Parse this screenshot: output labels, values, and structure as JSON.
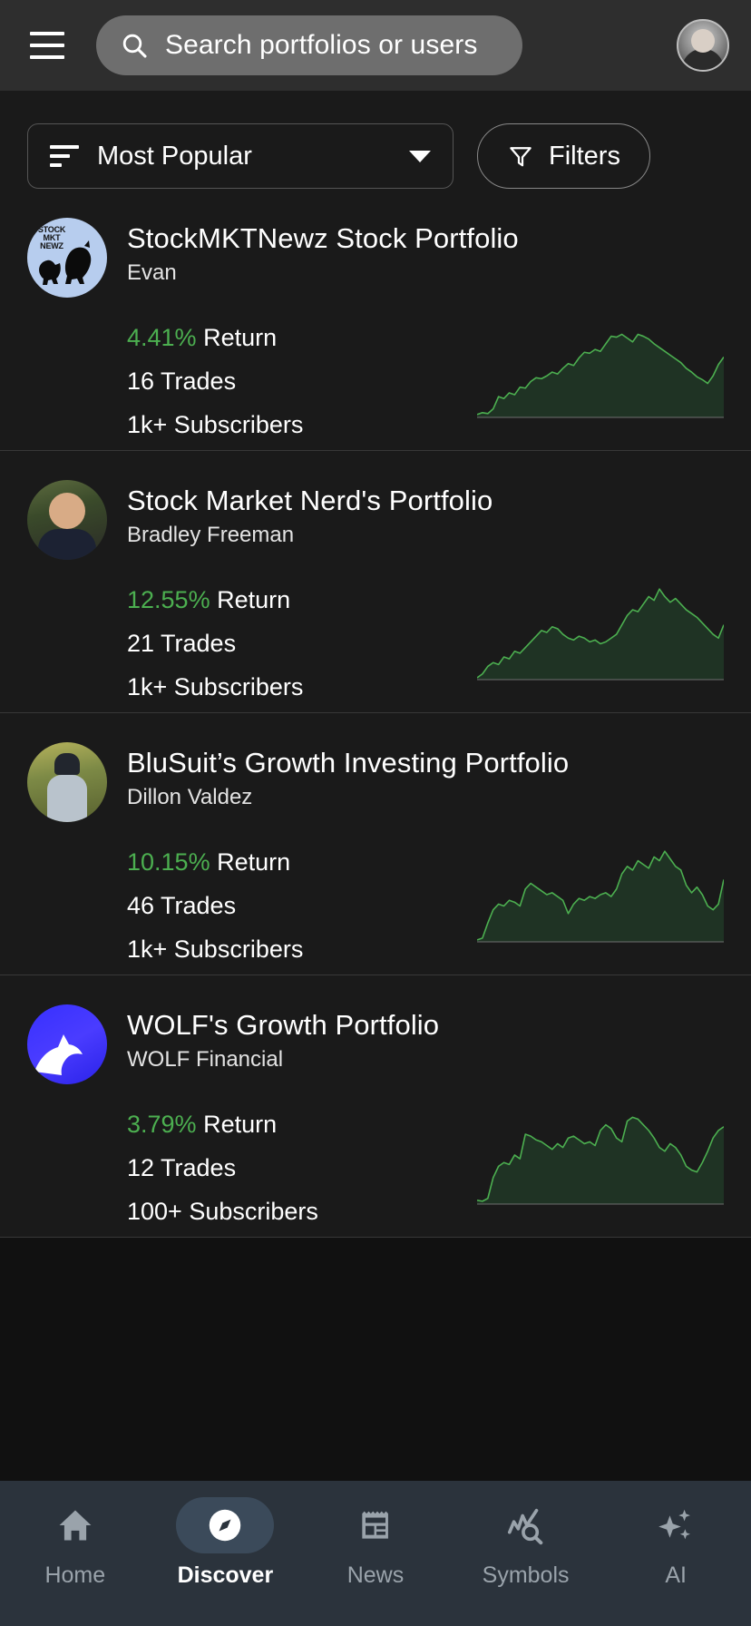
{
  "header": {
    "menu_icon": "hamburger-menu-icon",
    "search": {
      "placeholder": "Search portfolios or users",
      "icon": "search-icon"
    },
    "avatar": "user-avatar"
  },
  "controls": {
    "sort": {
      "label": "Most Popular",
      "icon": "sort-icon",
      "caret": "chevron-down-icon"
    },
    "filters": {
      "label": "Filters",
      "icon": "funnel-icon"
    }
  },
  "colors": {
    "background": "#1A1A1A",
    "header_bg": "#2E2E2E",
    "search_bg": "#6E6E6E",
    "return_green": "#4CAF50",
    "spark_line": "#4CAF50",
    "spark_fill": "#1F3324",
    "nav_bg": "#2B333C",
    "nav_active_pill": "#3B4A5A",
    "nav_inactive_text": "#9AA3AB",
    "divider": "#383838"
  },
  "portfolios": [
    {
      "title": "StockMKTNewz Stock Portfolio",
      "author": "Evan",
      "return": "4.41%",
      "return_word": "Return",
      "trades": "16 Trades",
      "subscribers": "1k+ Subscribers",
      "avatar": "stockmktnewz-bull-bear-logo",
      "chart_data": {
        "type": "area",
        "title": "StockMKTNewz Stock Portfolio sparkline",
        "xlabel": "",
        "ylabel": "",
        "grid": false,
        "legend": null,
        "ylim": [
          0,
          100
        ],
        "values": [
          3,
          5,
          4,
          9,
          22,
          20,
          26,
          24,
          32,
          31,
          38,
          42,
          41,
          44,
          48,
          46,
          52,
          57,
          55,
          63,
          69,
          68,
          72,
          70,
          78,
          86,
          85,
          88,
          84,
          80,
          88,
          86,
          83,
          78,
          74,
          70,
          66,
          62,
          58,
          52,
          48,
          43,
          40,
          36,
          44,
          56,
          64
        ]
      }
    },
    {
      "title": "Stock Market Nerd's Portfolio",
      "author": "Bradley Freeman",
      "return": "12.55%",
      "return_word": "Return",
      "trades": "21 Trades",
      "subscribers": "1k+ Subscribers",
      "avatar": "bradley-freeman-photo",
      "chart_data": {
        "type": "area",
        "title": "Stock Market Nerd's Portfolio sparkline",
        "xlabel": "",
        "ylabel": "",
        "grid": false,
        "legend": null,
        "ylim": [
          0,
          100
        ],
        "values": [
          2,
          6,
          14,
          18,
          16,
          24,
          22,
          30,
          28,
          34,
          40,
          46,
          52,
          50,
          56,
          54,
          48,
          44,
          42,
          46,
          44,
          40,
          42,
          38,
          40,
          44,
          48,
          58,
          68,
          74,
          72,
          80,
          88,
          84,
          96,
          88,
          82,
          86,
          80,
          74,
          70,
          66,
          60,
          54,
          48,
          44,
          58
        ]
      }
    },
    {
      "title": "BluSuit’s Growth Investing Portfolio",
      "author": "Dillon Valdez",
      "return": "10.15%",
      "return_word": "Return",
      "trades": "46 Trades",
      "subscribers": "1k+ Subscribers",
      "avatar": "dillon-valdez-photo",
      "chart_data": {
        "type": "area",
        "title": "BluSuit’s Growth Investing Portfolio sparkline",
        "xlabel": "",
        "ylabel": "",
        "grid": false,
        "legend": null,
        "ylim": [
          0,
          100
        ],
        "values": [
          2,
          4,
          20,
          34,
          40,
          38,
          44,
          42,
          38,
          56,
          62,
          58,
          54,
          50,
          52,
          48,
          44,
          30,
          40,
          46,
          44,
          48,
          46,
          50,
          52,
          48,
          56,
          72,
          80,
          76,
          86,
          82,
          78,
          90,
          86,
          96,
          88,
          80,
          76,
          60,
          52,
          58,
          50,
          38,
          34,
          40,
          66
        ]
      }
    },
    {
      "title": "WOLF's Growth Portfolio",
      "author": "WOLF Financial",
      "return": "3.79%",
      "return_word": "Return",
      "trades": "12 Trades",
      "subscribers": "100+ Subscribers",
      "avatar": "wolf-financial-logo",
      "chart_data": {
        "type": "area",
        "title": "WOLF's Growth Portfolio sparkline",
        "xlabel": "",
        "ylabel": "",
        "grid": false,
        "legend": null,
        "ylim": [
          0,
          100
        ],
        "values": [
          4,
          3,
          6,
          28,
          40,
          44,
          42,
          52,
          48,
          74,
          72,
          68,
          66,
          62,
          58,
          64,
          60,
          70,
          72,
          68,
          64,
          66,
          62,
          78,
          84,
          80,
          70,
          66,
          88,
          92,
          90,
          84,
          78,
          70,
          60,
          56,
          64,
          60,
          52,
          40,
          36,
          34,
          44,
          56,
          70,
          78,
          82
        ]
      }
    }
  ],
  "bottom_nav": {
    "items": [
      {
        "label": "Home",
        "icon": "home-icon",
        "active": false
      },
      {
        "label": "Discover",
        "icon": "compass-icon",
        "active": true
      },
      {
        "label": "News",
        "icon": "newspaper-icon",
        "active": false
      },
      {
        "label": "Symbols",
        "icon": "chart-search-icon",
        "active": false
      },
      {
        "label": "AI",
        "icon": "sparkles-icon",
        "active": false
      }
    ]
  }
}
